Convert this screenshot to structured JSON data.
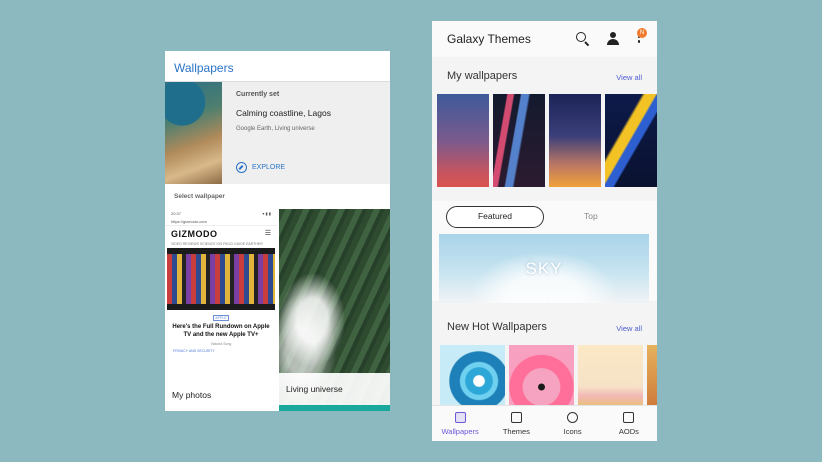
{
  "left_phone": {
    "title": "Wallpapers",
    "currently_set": {
      "label": "Currently set",
      "name": "Calming coastline, Lagos",
      "source": "Google Earth, Living universe",
      "explore": "EXPLORE"
    },
    "select_label": "Select wallpaper",
    "tiles": [
      {
        "caption": "My photos"
      },
      {
        "caption": "Living universe"
      }
    ],
    "mini_page": {
      "time": "20:37",
      "url": "https://gizmodo.com",
      "logo": "GIZMODO",
      "nav": "VIDEO   REVIEWS   SCIENCE   IO9   FIELD GUIDE   EARTHER",
      "tag": "APPLE",
      "headline": "Here's the Full Rundown on Apple TV and the new Apple TV+",
      "byline": "Victoria Song",
      "footer": "PRIVACY AND SECURITY"
    }
  },
  "right_phone": {
    "app_title": "Galaxy Themes",
    "badge": "N",
    "my_wallpapers": {
      "heading": "My wallpapers",
      "view_all": "View all"
    },
    "tabs_toggle": {
      "featured": "Featured",
      "top": "Top"
    },
    "banner_text": "SKY",
    "new_hot": {
      "heading": "New Hot Wallpapers",
      "view_all": "View all"
    },
    "bottom_tabs": [
      {
        "label": "Wallpapers",
        "icon": "image-icon",
        "active": true
      },
      {
        "label": "Themes",
        "icon": "brush-icon",
        "active": false
      },
      {
        "label": "Icons",
        "icon": "icons-icon",
        "active": false
      },
      {
        "label": "AODs",
        "icon": "clock-screen-icon",
        "active": false
      }
    ],
    "colors": {
      "accent": "#6c58d8",
      "view_all": "#4e5ed0",
      "badge": "#f07b2c"
    }
  }
}
